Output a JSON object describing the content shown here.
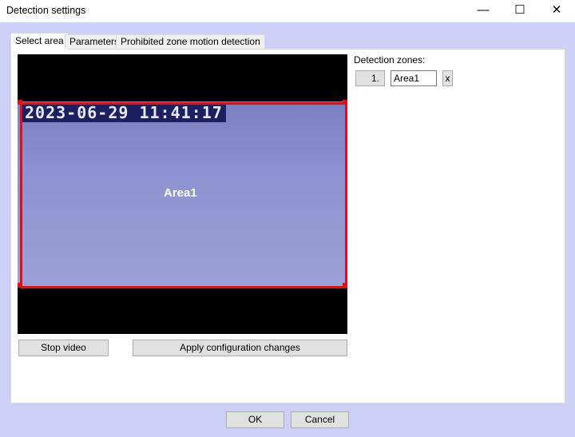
{
  "window": {
    "title": "Detection settings",
    "minimize": "—",
    "maximize": "☐",
    "close": "✕"
  },
  "tabs": [
    {
      "label": "Select area"
    },
    {
      "label": "Parameters"
    },
    {
      "label": "Prohibited zone motion detection"
    }
  ],
  "video": {
    "timestamp": "2023-06-29 11:41:17",
    "zone_label": "Area1",
    "zone_color": "#e01010"
  },
  "buttons": {
    "stop_video": "Stop video",
    "apply": "Apply configuration changes",
    "ok": "OK",
    "cancel": "Cancel"
  },
  "zones": {
    "label": "Detection zones:",
    "items": [
      {
        "index": "1.",
        "name": "Area1",
        "remove": "x"
      }
    ]
  }
}
